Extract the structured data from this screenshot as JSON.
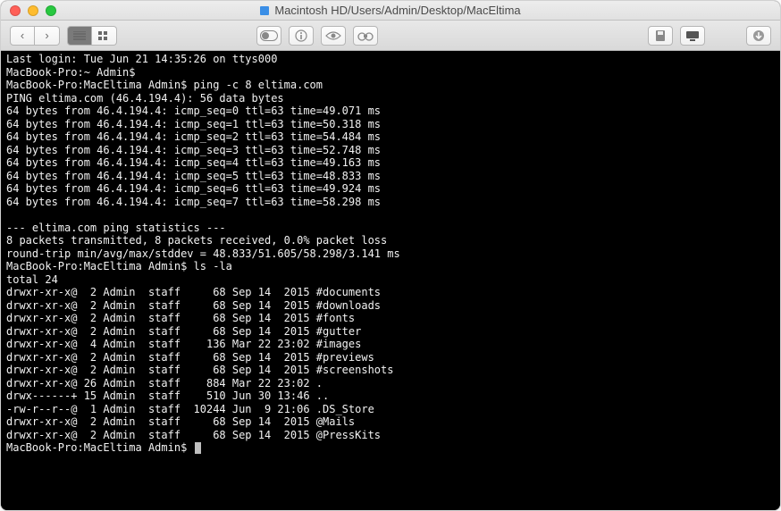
{
  "window": {
    "title": "Macintosh HD/Users/Admin/Desktop/MacEltima"
  },
  "terminal": {
    "last_login": "Last login: Tue Jun 21 14:35:26 on ttys000",
    "prompt_home": "MacBook-Pro:~ Admin$ ",
    "prompt_dir": "MacBook-Pro:MacEltima Admin$ ",
    "cmd_ping": "ping -c 8 eltima.com",
    "ping_header": "PING eltima.com (46.4.194.4): 56 data bytes",
    "ping_replies": [
      "64 bytes from 46.4.194.4: icmp_seq=0 ttl=63 time=49.071 ms",
      "64 bytes from 46.4.194.4: icmp_seq=1 ttl=63 time=50.318 ms",
      "64 bytes from 46.4.194.4: icmp_seq=2 ttl=63 time=54.484 ms",
      "64 bytes from 46.4.194.4: icmp_seq=3 ttl=63 time=52.748 ms",
      "64 bytes from 46.4.194.4: icmp_seq=4 ttl=63 time=49.163 ms",
      "64 bytes from 46.4.194.4: icmp_seq=5 ttl=63 time=48.833 ms",
      "64 bytes from 46.4.194.4: icmp_seq=6 ttl=63 time=49.924 ms",
      "64 bytes from 46.4.194.4: icmp_seq=7 ttl=63 time=58.298 ms"
    ],
    "ping_stats_hdr": "--- eltima.com ping statistics ---",
    "ping_stats_1": "8 packets transmitted, 8 packets received, 0.0% packet loss",
    "ping_stats_2": "round-trip min/avg/max/stddev = 48.833/51.605/58.298/3.141 ms",
    "cmd_ls": "ls -la",
    "ls_total": "total 24",
    "ls_rows": [
      "drwxr-xr-x@  2 Admin  staff     68 Sep 14  2015 #documents",
      "drwxr-xr-x@  2 Admin  staff     68 Sep 14  2015 #downloads",
      "drwxr-xr-x@  2 Admin  staff     68 Sep 14  2015 #fonts",
      "drwxr-xr-x@  2 Admin  staff     68 Sep 14  2015 #gutter",
      "drwxr-xr-x@  4 Admin  staff    136 Mar 22 23:02 #images",
      "drwxr-xr-x@  2 Admin  staff     68 Sep 14  2015 #previews",
      "drwxr-xr-x@  2 Admin  staff     68 Sep 14  2015 #screenshots",
      "drwxr-xr-x@ 26 Admin  staff    884 Mar 22 23:02 .",
      "drwx------+ 15 Admin  staff    510 Jun 30 13:46 ..",
      "-rw-r--r--@  1 Admin  staff  10244 Jun  9 21:06 .DS_Store",
      "drwxr-xr-x@  2 Admin  staff     68 Sep 14  2015 @Mails",
      "drwxr-xr-x@  2 Admin  staff     68 Sep 14  2015 @PressKits"
    ]
  }
}
